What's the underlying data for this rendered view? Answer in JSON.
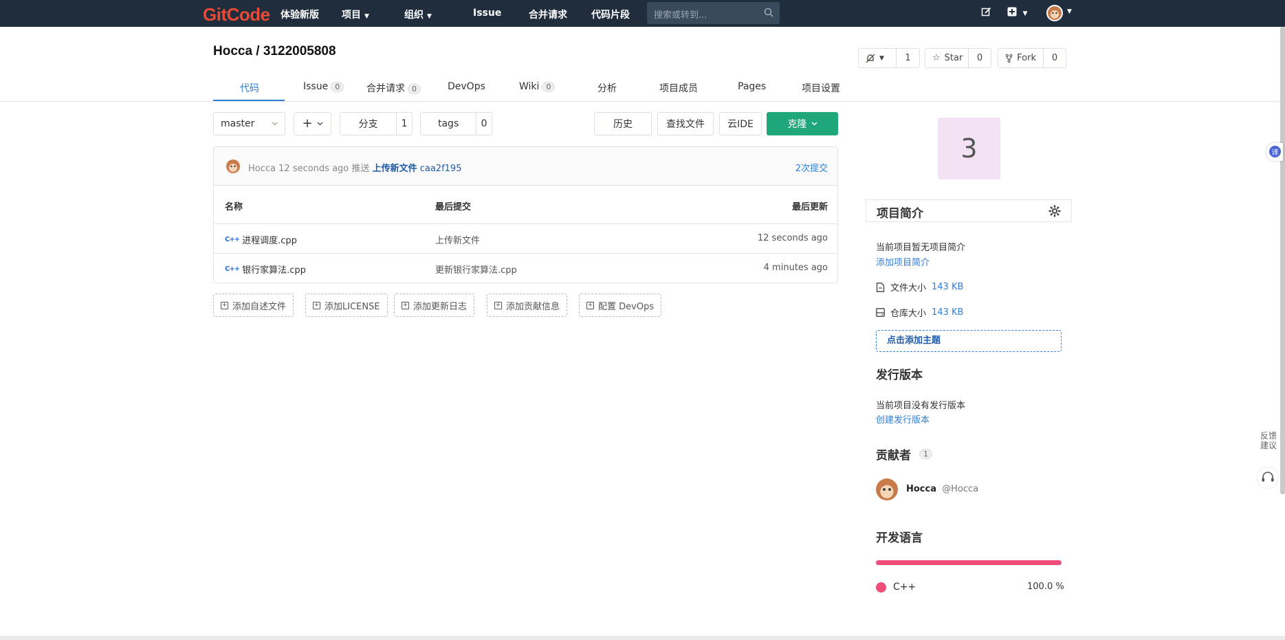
{
  "nav": {
    "logo": "GitCode",
    "try_new": "体验新版",
    "projects": "项目",
    "orgs": "组织",
    "issue": "Issue",
    "merge_requests": "合并请求",
    "snippets": "代码片段",
    "search_placeholder": "搜索或转到..."
  },
  "project": {
    "title": "Hocca / 3122005808",
    "notify_count": "1",
    "star_label": "Star",
    "star_count": "0",
    "fork_label": "Fork",
    "fork_count": "0"
  },
  "tabs": [
    {
      "label": "代码"
    },
    {
      "label": "Issue",
      "badge": "0"
    },
    {
      "label": "合并请求",
      "badge": "0"
    },
    {
      "label": "DevOps"
    },
    {
      "label": "Wiki",
      "badge": "0"
    },
    {
      "label": "分析"
    },
    {
      "label": "项目成员"
    },
    {
      "label": "Pages"
    },
    {
      "label": "项目设置"
    }
  ],
  "toolbar": {
    "branch": "master",
    "add": "+",
    "branches_label": "分支",
    "branches_count": "1",
    "tags_label": "tags",
    "tags_count": "0",
    "history": "历史",
    "find_file": "查找文件",
    "cloud_ide": "云IDE",
    "clone": "克隆"
  },
  "last_commit": {
    "author": "Hocca",
    "time": "12 seconds ago",
    "action": "推送",
    "message": "上传新文件",
    "sha": "caa2f195",
    "commits_link": "2次提交"
  },
  "table": {
    "col_name": "名称",
    "col_commit": "最后提交",
    "col_updated": "最后更新",
    "rows": [
      {
        "name": "进程调度.cpp",
        "commit": "上传新文件",
        "updated": "12 seconds ago"
      },
      {
        "name": "银行家算法.cpp",
        "commit": "更新银行家算法.cpp",
        "updated": "4 minutes ago"
      }
    ]
  },
  "add_buttons": [
    "添加自述文件",
    "添加LICENSE",
    "添加更新日志",
    "添加贡献信息",
    "配置 DevOps"
  ],
  "sidebar": {
    "avatar_letter": "3",
    "intro_title": "项目简介",
    "intro_empty": "当前项目暂无项目简介",
    "intro_add": "添加项目简介",
    "file_size_label": "文件大小",
    "file_size_value": "143 KB",
    "repo_size_label": "仓库大小",
    "repo_size_value": "143 KB",
    "add_topic": "点击添加主题",
    "releases_title": "发行版本",
    "releases_empty": "当前项目没有发行版本",
    "releases_create": "创建发行版本",
    "contributors_title": "贡献者",
    "contributors_count": "1",
    "contributor_name": "Hocca",
    "contributor_handle": "@Hocca",
    "languages_title": "开发语言",
    "language_name": "C++",
    "language_percent": "100.0 %",
    "language_color": "#ef4d7a"
  },
  "widgets": {
    "translate_icon": "译",
    "feedback": "反馈建议"
  }
}
